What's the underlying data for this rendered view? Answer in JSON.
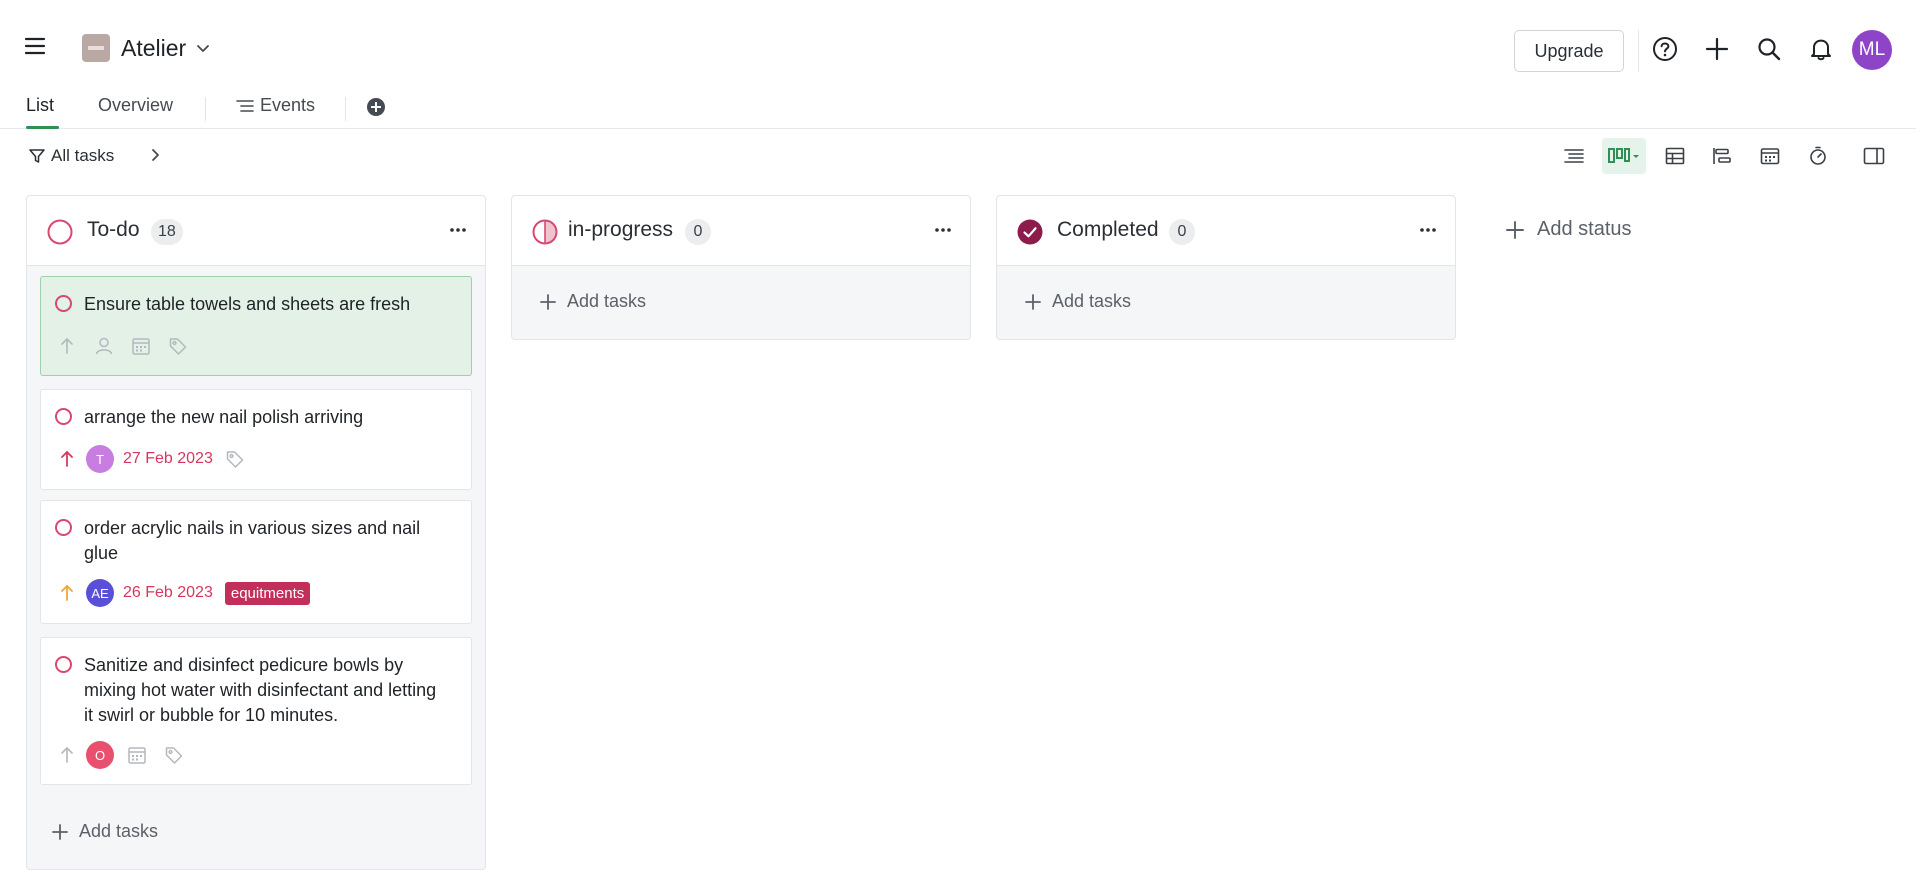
{
  "header": {
    "project_name": "Atelier",
    "upgrade_label": "Upgrade",
    "avatar_initials": "ML",
    "avatar_color": "#8e44c7",
    "icons": [
      "menu-icon",
      "help-icon",
      "plus-icon",
      "search-icon",
      "bell-icon"
    ]
  },
  "tabs": {
    "list": "List",
    "overview": "Overview",
    "events": "Events"
  },
  "toolbar": {
    "filter_label": "All tasks",
    "views": [
      "list-view-icon",
      "board-view-icon",
      "table-view-icon",
      "gantt-view-icon",
      "calendar-view-icon",
      "timer-view-icon",
      "sidebar-toggle-icon"
    ],
    "active_view": "board"
  },
  "columns": [
    {
      "title": "To-do",
      "count": "18",
      "add_label": "Add tasks",
      "status_color": "#d9486f",
      "cards": [
        {
          "text": "Ensure table towels and sheets are fresh",
          "selected": true
        },
        {
          "text": "arrange the new nail polish arriving",
          "avatar": "T",
          "avatar_color": "#c77ee0",
          "date": "27 Feb 2023",
          "priority_color": "#d9365f"
        },
        {
          "text": "order acrylic nails in various sizes and nail glue",
          "avatar": "AE",
          "avatar_color": "#5a4fd8",
          "date": "26 Feb 2023",
          "tag": "equitments",
          "priority_color": "#f2a33a"
        },
        {
          "text": "Sanitize and disinfect pedicure bowls by mixing hot water with disinfectant and letting it swirl or bubble for 10 minutes.",
          "avatar": "O",
          "avatar_color": "#e8506e"
        }
      ]
    },
    {
      "title": "in-progress",
      "count": "0",
      "add_label": "Add tasks",
      "status_color": "#d9486f"
    },
    {
      "title": "Completed",
      "count": "0",
      "add_label": "Add tasks",
      "status_color": "#8c1c4c"
    }
  ],
  "add_status_label": "Add status"
}
